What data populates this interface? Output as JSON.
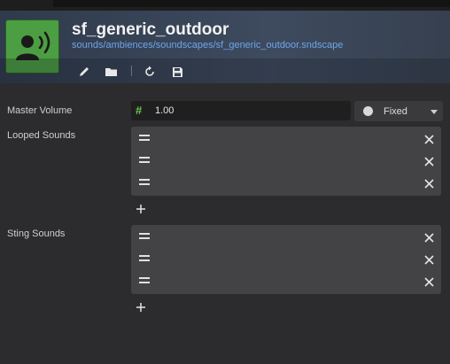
{
  "asset": {
    "title": "sf_generic_outdoor",
    "path": "sounds/ambiences/soundscapes/sf_generic_outdoor.sndscape",
    "icon": "speaker-person-icon",
    "icon_color": "#4c9e42"
  },
  "toolbar": {
    "buttons": [
      {
        "name": "edit-button",
        "icon": "pencil-icon"
      },
      {
        "name": "browse-button",
        "icon": "folder-icon"
      },
      {
        "name": "reload-button",
        "icon": "refresh-icon"
      },
      {
        "name": "save-button",
        "icon": "floppy-disk-icon"
      }
    ]
  },
  "fields": {
    "master_volume": {
      "label": "Master Volume",
      "value": "1.00",
      "mode": "Fixed",
      "icon": "hash-icon",
      "accent": "#6ec44c"
    },
    "looped_sounds": {
      "label": "Looped Sounds",
      "items": [
        "",
        "",
        ""
      ],
      "add_icon": "plus-icon",
      "remove_icon": "close-icon",
      "drag_icon": "drag-handle-icon"
    },
    "sting_sounds": {
      "label": "Sting Sounds",
      "items": [
        "",
        "",
        ""
      ],
      "add_icon": "plus-icon",
      "remove_icon": "close-icon",
      "drag_icon": "drag-handle-icon"
    }
  },
  "colors": {
    "background": "#2c2c2e",
    "header": "#3e4a5e",
    "link": "#6ea6ea"
  }
}
